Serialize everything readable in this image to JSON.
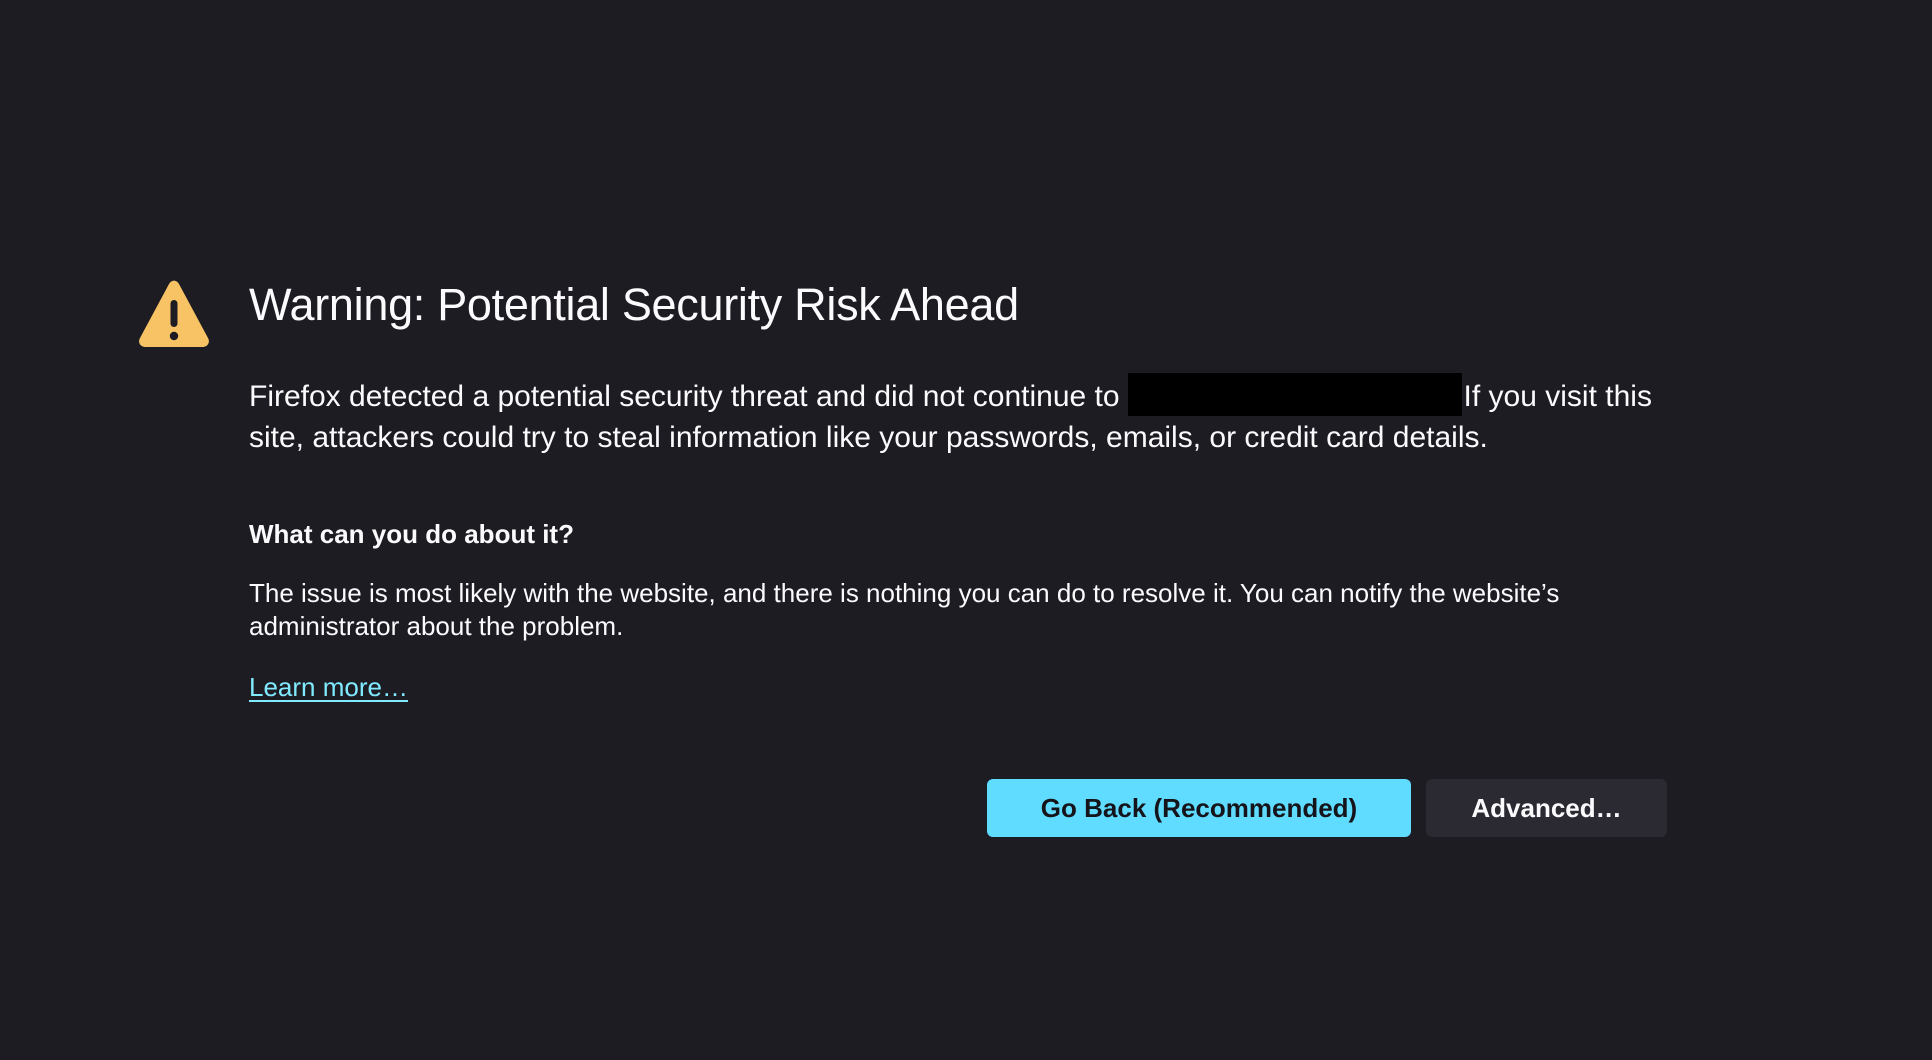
{
  "page": {
    "title": "Warning: Potential Security Risk Ahead",
    "intro_before": "Firefox detected a potential security threat and did not continue to",
    "intro_after": "If you visit this site, attackers could try to steal information like your passwords, emails, or credit card details.",
    "subheading": "What can you do about it?",
    "detail": "The issue is most likely with the website, and there is nothing you can do to resolve it. You can notify the website’s administrator about the problem.",
    "learn_more": "Learn more…"
  },
  "buttons": {
    "go_back": "Go Back (Recommended)",
    "advanced": "Advanced…"
  },
  "icons": {
    "warning": "warning-triangle-icon"
  },
  "colors": {
    "background": "#1d1c23",
    "text": "#fbfbfe",
    "warning_icon": "#ffbd4f",
    "link": "#80ebff",
    "primary_button": "#5fdcff",
    "secondary_button": "#2b2a33"
  }
}
